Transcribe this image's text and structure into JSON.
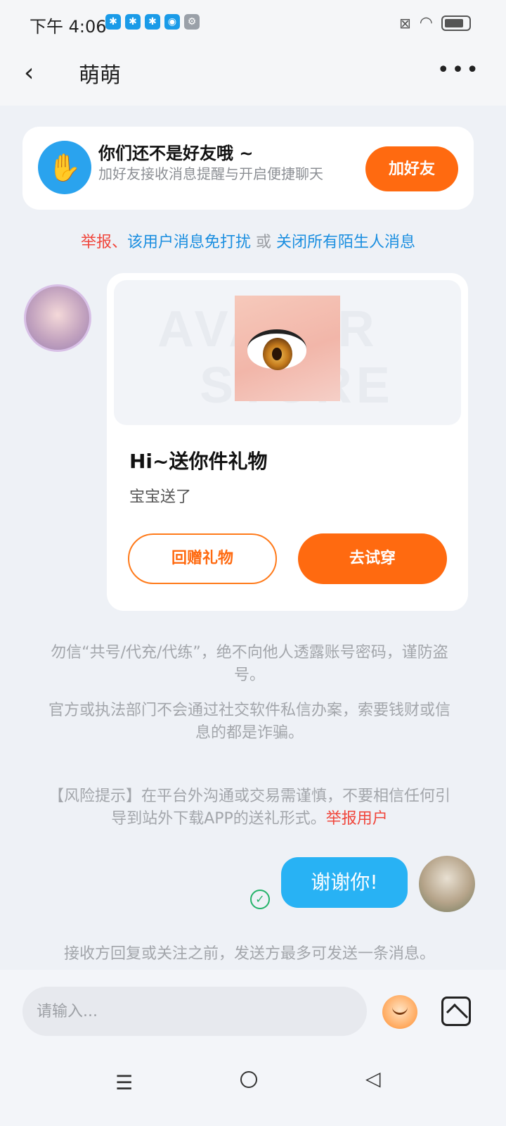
{
  "status_bar": {
    "time": "下午 4:06"
  },
  "nav": {
    "title": "萌萌"
  },
  "friend_card": {
    "title": "你们还不是好友哦 ~",
    "desc": "加好友接收消息提醒与开启便捷聊天",
    "button": "加好友"
  },
  "report_line": {
    "report": "举报",
    "sep": "、",
    "mute": "该用户消息免打扰",
    "or": " 或 ",
    "close_all": "关闭所有陌生人消息"
  },
  "gift": {
    "watermark_line1": "AVATAR",
    "watermark_line2": "STORE",
    "title": "Hi~送你件礼物",
    "subtitle": "宝宝送了",
    "return_button": "回赠礼物",
    "try_button": "去试穿"
  },
  "notices": {
    "fraud1": "勿信“共号/代充/代练”，绝不向他人透露账号密码，谨防盗号。",
    "fraud2": "官方或执法部门不会通过社交软件私信办案，索要钱财或信息的都是诈骗。",
    "risk": "【风险提示】在平台外沟通或交易需谨慎，不要相信任何引导到站外下载APP的送礼形式。",
    "risk_report": "举报用户",
    "limit": "接收方回复或关注之前，发送方最多可发送一条消息。"
  },
  "message": {
    "sent_text": "谢谢你!"
  },
  "input": {
    "placeholder": "请输入..."
  },
  "colors": {
    "accent_orange": "#ff6a10",
    "bubble_blue": "#28b2f4",
    "link_blue": "#1a8ee0",
    "report_red": "#f0463c"
  }
}
